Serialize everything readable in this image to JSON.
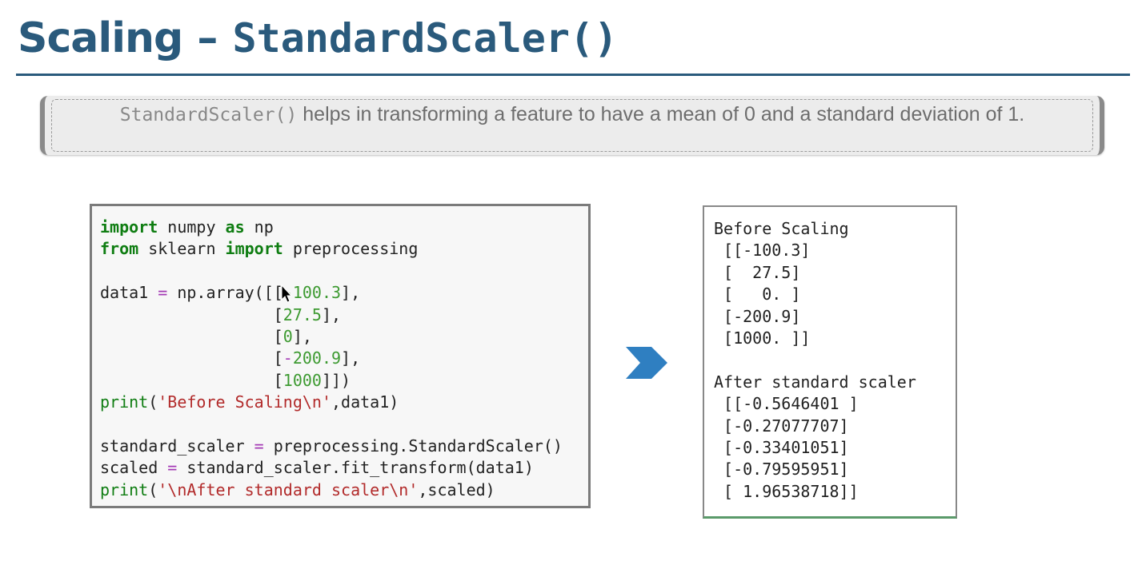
{
  "slide": {
    "title_word": "Scaling",
    "title_dash": " – ",
    "title_code": "StandardScaler()",
    "note_code": "StandardScaler()",
    "note_text": " helps in transforming a feature to have a mean of 0 and a standard deviation of 1."
  },
  "code_lines": [
    "import numpy as np",
    "from sklearn import preprocessing",
    "",
    "data1 = np.array([[-100.3],",
    "                  [27.5],",
    "                  [0],",
    "                  [-200.9],",
    "                  [1000]])",
    "print('Before Scaling\\n',data1)",
    "",
    "standard_scaler = preprocessing.StandardScaler()",
    "scaled = standard_scaler.fit_transform(data1)",
    "print('\\nAfter standard scaler\\n',scaled)"
  ],
  "output_lines": [
    "Before Scaling",
    " [[-100.3]",
    " [  27.5]",
    " [   0. ]",
    " [-200.9]",
    " [1000. ]]",
    "",
    "After standard scaler",
    " [[-0.5646401 ]",
    " [-0.27077707]",
    " [-0.33401051]",
    " [-0.79595951]",
    " [ 1.96538718]]"
  ],
  "colors": {
    "title": "#2a5a7c",
    "arrow": "#2f7fc1",
    "keyword": "#0f7d12",
    "string": "#b22b2b",
    "number": "#3d9a31",
    "operator": "#a43bb5"
  },
  "icons": {
    "arrow": "chevron-right-icon",
    "cursor": "mouse-pointer-icon"
  }
}
